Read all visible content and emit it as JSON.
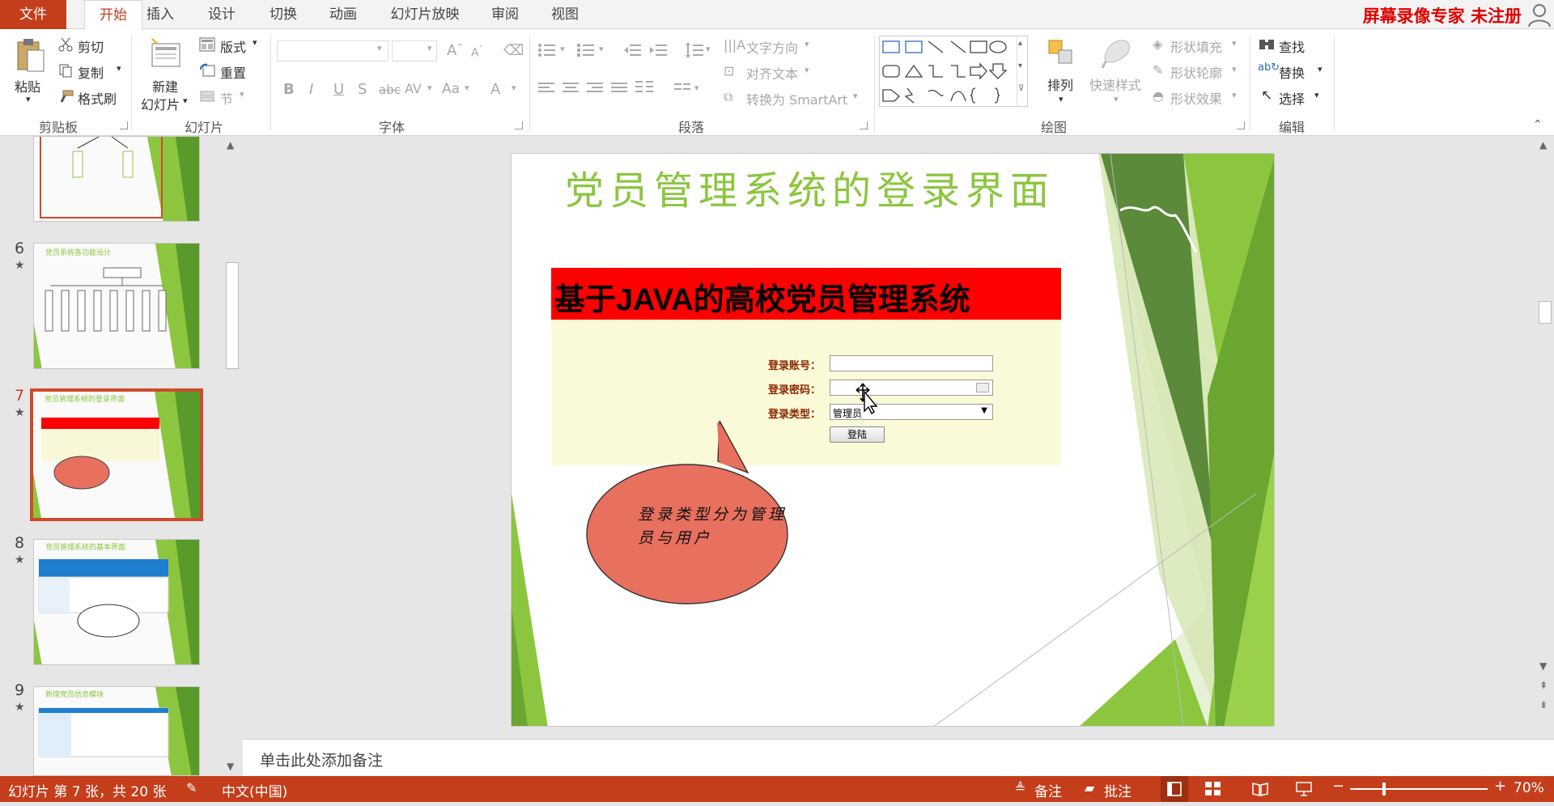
{
  "tabs": {
    "file": "文件",
    "items": [
      "开始",
      "插入",
      "设计",
      "切换",
      "动画",
      "幻灯片放映",
      "审阅",
      "视图"
    ]
  },
  "watermark": "屏幕录像专家  未注册",
  "ribbon": {
    "clipboard": {
      "paste": "粘贴",
      "cut": "剪切",
      "copy": "复制",
      "format_painter": "格式刷",
      "label": "剪贴板"
    },
    "slides": {
      "new_slide_line1": "新建",
      "new_slide_line2": "幻灯片",
      "layout": "版式",
      "reset": "重置",
      "section": "节",
      "label": "幻灯片"
    },
    "font": {
      "label": "字体",
      "bold": "B",
      "italic": "I",
      "underline": "U",
      "shadow": "S",
      "strike": "abc",
      "spacing": "AV",
      "case": "Aa",
      "color": "A"
    },
    "paragraph": {
      "text_direction": "文字方向",
      "align_text": "对齐文本",
      "smartart": "转换为 SmartArt",
      "label": "段落"
    },
    "drawing": {
      "arrange": "排列",
      "quick_styles": "快速样式",
      "fill": "形状填充",
      "outline": "形状轮廓",
      "effects": "形状效果",
      "label": "绘图"
    },
    "editing": {
      "find": "查找",
      "replace": "替换",
      "select": "选择",
      "label": "编辑"
    }
  },
  "thumbnails": [
    {
      "num": "6",
      "title": "党员系统各功能设计"
    },
    {
      "num": "7",
      "title": "党员管理系统的登录界面"
    },
    {
      "num": "8",
      "title": "党员管理系统的基本界面"
    },
    {
      "num": "9",
      "title": "新增党员信息模块"
    }
  ],
  "slide": {
    "title": "党员管理系统的登录界面",
    "banner": "基于JAVA的高校党员管理系统",
    "login": {
      "account_label": "登录账号：",
      "password_label": "登录密码：",
      "type_label": "登录类型：",
      "type_value": "管理员",
      "submit": "登陆"
    },
    "callout": "登录类型分为管理员与用户"
  },
  "notes_placeholder": "单击此处添加备注",
  "status": {
    "slide_info": "幻灯片 第 7 张，共 20 张",
    "language": "中文(中国)",
    "notes": "备注",
    "comments": "批注",
    "zoom": "70%"
  },
  "colors": {
    "accent": "#c43e1c",
    "slide_green": "#8cc63f",
    "banner_red": "#ff0000",
    "callout": "#e8705f"
  }
}
